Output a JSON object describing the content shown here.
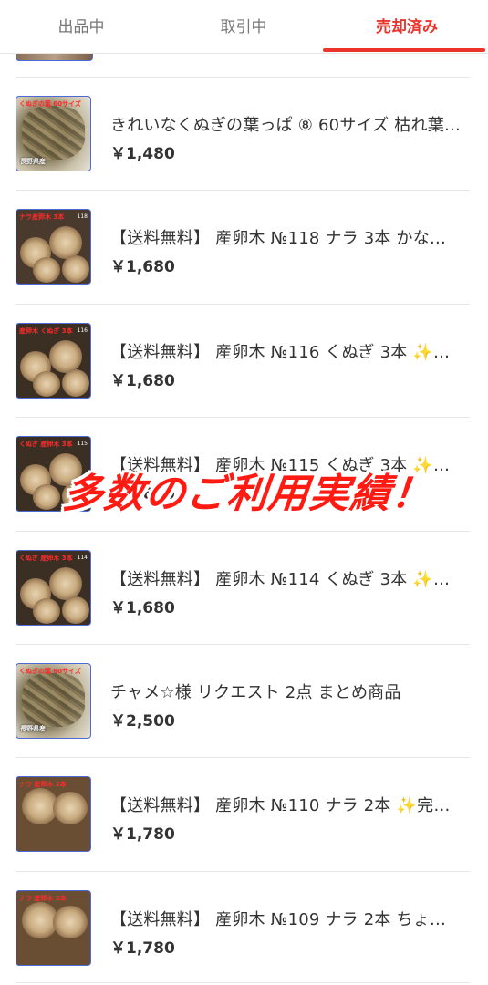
{
  "tabs": [
    {
      "label": "出品中",
      "active": false
    },
    {
      "label": "取引中",
      "active": false
    },
    {
      "label": "売却済み",
      "active": true
    }
  ],
  "accent_color": "#ea352d",
  "items": [
    {
      "title": "きれいなくぬぎの葉っぱ ⑧ 60サイズ 枯れ葉…",
      "price": "￥1,480",
      "thumb": {
        "label": "くぬぎの葉 60サイズ",
        "foot": "長野県産",
        "kind": "leaves"
      }
    },
    {
      "title": "【送料無料】 産卵木 №118 ナラ 3本 かな…",
      "price": "￥1,680",
      "thumb": {
        "label": "ナラ産卵木 3本",
        "num": "118",
        "kind": "wood"
      }
    },
    {
      "title": "【送料無料】 産卵木 №116 くぬぎ 3本 ✨…",
      "price": "￥1,680",
      "thumb": {
        "label": "産卵木 くぬぎ 3本",
        "num": "116",
        "kind": "wood-dark"
      }
    },
    {
      "title": "【送料無料】 産卵木 №115 くぬぎ 3本 ✨…",
      "price": "￥1,680",
      "thumb": {
        "label": "くぬぎ 産卵木 3本",
        "num": "115",
        "kind": "wood-dark"
      }
    },
    {
      "title": "【送料無料】 産卵木 №114 くぬぎ 3本 ✨…",
      "price": "￥1,680",
      "thumb": {
        "label": "くぬぎ 産卵木 3本",
        "num": "114",
        "kind": "wood-dark"
      }
    },
    {
      "title": "チャメ☆様 リクエスト 2点 まとめ商品",
      "price": "￥2,500",
      "thumb": {
        "label": "くぬぎの葉 60サイズ",
        "foot": "長野県産",
        "kind": "leaves"
      }
    },
    {
      "title": "【送料無料】 産卵木 №110 ナラ 2本 ✨完…",
      "price": "￥1,780",
      "thumb": {
        "label": "ナラ 産卵木 2本",
        "kind": "wood-light"
      }
    },
    {
      "title": "【送料無料】 産卵木 №109 ナラ 2本 ちょ…",
      "price": "￥1,780",
      "thumb": {
        "label": "ナラ 産卵木 2本",
        "kind": "wood-light"
      }
    }
  ],
  "overlay": {
    "text": "多数のご利用実績！",
    "color": "#ff1a12"
  }
}
